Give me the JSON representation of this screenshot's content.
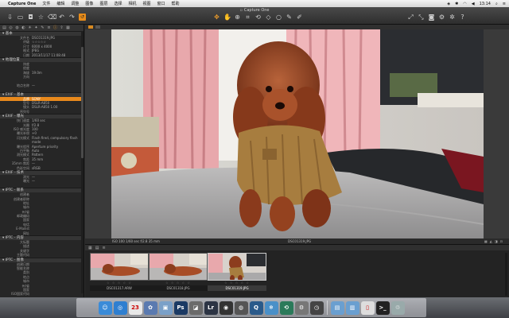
{
  "menubar": {
    "app_name": "Capture One",
    "items": [
      "文件",
      "编辑",
      "调整",
      "图像",
      "图层",
      "选择",
      "相机",
      "视图",
      "窗口",
      "帮助"
    ],
    "clock": "13:14"
  },
  "window": {
    "title": "Capture One"
  },
  "left_panel": {
    "sections": [
      {
        "title": "▾ 基本",
        "rows": [
          {
            "k": "文件名",
            "v": "DSC01319.JPG"
          },
          {
            "k": "评级",
            "v": "☆☆☆☆☆"
          },
          {
            "k": "尺寸",
            "v": "6000 x 4000"
          },
          {
            "k": "格式",
            "v": "JPEG"
          },
          {
            "k": "日期",
            "v": "2013/11/17 11:08:48"
          }
        ]
      },
      {
        "title": "▾ 地理位置",
        "rows": [
          {
            "k": "纬度",
            "v": ""
          },
          {
            "k": "经度",
            "v": ""
          },
          {
            "k": "海拔",
            "v": "19.0m"
          },
          {
            "k": "方向",
            "v": ""
          },
          {
            "k": "",
            "v": ""
          },
          {
            "k": "地点名称",
            "v": "—"
          },
          {
            "k": "",
            "v": ""
          }
        ]
      },
      {
        "title": "▾ EXIF - 基本",
        "rows": [
          {
            "k": "品牌",
            "v": "SONY",
            "highlight": true
          },
          {
            "k": "型号",
            "v": "DSLR-A850"
          },
          {
            "k": "镜头",
            "v": "DSLR-A850 1.00"
          },
          {
            "k": "序列号",
            "v": ""
          }
        ]
      },
      {
        "title": "▾ EXIF - 曝光",
        "rows": [
          {
            "k": "快门速度",
            "v": "1/60 sec"
          },
          {
            "k": "光圈",
            "v": "f/2.8"
          },
          {
            "k": "ISO 感光度",
            "v": "100"
          },
          {
            "k": "曝光补偿",
            "v": "+0"
          },
          {
            "k": "闪光模式",
            "v": "Flash fired, compulsory flash"
          },
          {
            "k": "",
            "v": "mode"
          },
          {
            "k": "曝光程序",
            "v": "Aperture priority"
          },
          {
            "k": "白平衡",
            "v": "Auto"
          },
          {
            "k": "测光模式",
            "v": "Pattern"
          },
          {
            "k": "焦距",
            "v": "35 mm"
          },
          {
            "k": "35mm 焦距",
            "v": "—"
          },
          {
            "k": "色彩空间",
            "v": "sRGB"
          }
        ]
      },
      {
        "title": "▾ EXIF - 技术",
        "rows": [
          {
            "k": "测光",
            "v": "—"
          },
          {
            "k": "曝光",
            "v": "—"
          },
          {
            "k": "",
            "v": ""
          }
        ]
      },
      {
        "title": "▾ IPTC - 联系",
        "rows": [
          {
            "k": "创建者",
            "v": ""
          },
          {
            "k": "创建者职称",
            "v": ""
          },
          {
            "k": "地址",
            "v": ""
          },
          {
            "k": "城市",
            "v": ""
          },
          {
            "k": "州/省",
            "v": ""
          },
          {
            "k": "邮政编码",
            "v": ""
          },
          {
            "k": "国家",
            "v": ""
          },
          {
            "k": "电话",
            "v": ""
          },
          {
            "k": "E-Mailist",
            "v": ""
          },
          {
            "k": "网址",
            "v": ""
          }
        ]
      },
      {
        "title": "▾ IPTC - 内容",
        "rows": [
          {
            "k": "大标题",
            "v": ""
          },
          {
            "k": "描述",
            "v": ""
          },
          {
            "k": "关键字",
            "v": ""
          },
          {
            "k": "主题代码",
            "v": ""
          }
        ]
      },
      {
        "title": "▾ IPTC - 图像",
        "rows": [
          {
            "k": "创建日期",
            "v": ""
          },
          {
            "k": "智能名称",
            "v": ""
          },
          {
            "k": "类别",
            "v": ""
          },
          {
            "k": "地点",
            "v": ""
          },
          {
            "k": "城市",
            "v": ""
          },
          {
            "k": "州/省",
            "v": ""
          },
          {
            "k": "国家",
            "v": ""
          },
          {
            "k": "ISO国家代码",
            "v": ""
          }
        ]
      }
    ]
  },
  "viewer": {
    "exif_line": "ISO 100    1/60 sec    f/2.8    35 mm",
    "filename": "DSC01319.JPG"
  },
  "browser": {
    "thumbnails": [
      {
        "name": "DSC01317.ARW",
        "stars": "☆ ☆ ☆ ☆ ☆",
        "selected": false
      },
      {
        "name": "DSC01318.JPG",
        "stars": "☆ ☆ ☆ ☆ ☆",
        "selected": false
      },
      {
        "name": "DSC01319.JPG",
        "stars": "☆ ☆ ☆ ☆ ☆",
        "selected": true
      }
    ]
  },
  "dock": {
    "icons": [
      {
        "name": "finder-icon",
        "glyph": "☺",
        "color": "#3a8bd8"
      },
      {
        "name": "safari-icon",
        "glyph": "◎",
        "color": "#2f7fd0"
      },
      {
        "name": "calendar-icon",
        "glyph": "23",
        "color": "#e8e8e8"
      },
      {
        "name": "iphoto-icon",
        "glyph": "✿",
        "color": "#5a7ab0"
      },
      {
        "name": "preview-icon",
        "glyph": "▣",
        "color": "#7aa0c8"
      },
      {
        "name": "photoshop-icon",
        "glyph": "Ps",
        "color": "#1b3a64"
      },
      {
        "name": "photoshop-alt-icon",
        "glyph": "◪",
        "color": "#6b6b6b"
      },
      {
        "name": "lightroom-icon",
        "glyph": "Lr",
        "color": "#2c3444"
      },
      {
        "name": "capture-one-icon",
        "glyph": "◉",
        "color": "#333"
      },
      {
        "name": "aperture-icon",
        "glyph": "◍",
        "color": "#555"
      },
      {
        "name": "quicktime-icon",
        "glyph": "Q",
        "color": "#2a5a8a"
      },
      {
        "name": "snowflake-icon",
        "glyph": "❄",
        "color": "#4a90c8"
      },
      {
        "name": "time-machine-icon",
        "glyph": "⟲",
        "color": "#2b7a5a"
      },
      {
        "name": "system-preferences-icon",
        "glyph": "⚙",
        "color": "#777"
      },
      {
        "name": "activity-monitor-icon",
        "glyph": "◷",
        "color": "#444"
      },
      {
        "name": "applications-folder-icon",
        "glyph": "▤",
        "color": "#6a9fd0"
      },
      {
        "name": "documents-folder-icon",
        "glyph": "▥",
        "color": "#6a9fd0"
      },
      {
        "name": "file-icon",
        "glyph": "▯",
        "color": "#ddd"
      },
      {
        "name": "terminal-icon",
        "glyph": ">_",
        "color": "#222"
      },
      {
        "name": "trash-icon",
        "glyph": "♲",
        "color": "#9aa"
      }
    ]
  }
}
